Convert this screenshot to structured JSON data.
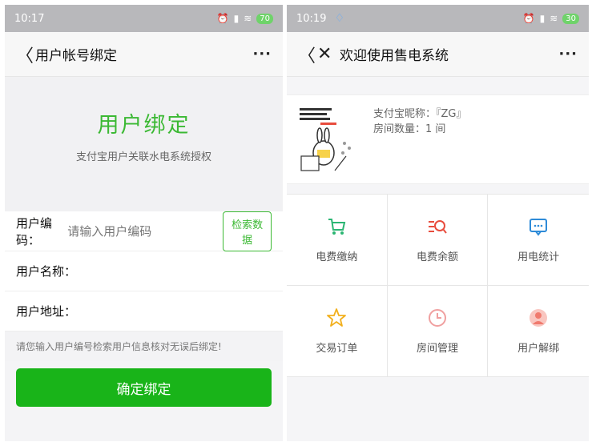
{
  "left": {
    "status": {
      "time": "10:17",
      "battery": "70"
    },
    "nav": {
      "title": "用户帐号绑定",
      "more": "···"
    },
    "hero": {
      "title": "用户绑定",
      "subtitle": "支付宝用户关联水电系统授权"
    },
    "form": {
      "code_label": "用户编码：",
      "code_placeholder": "请输入用户编码",
      "search_button": "检索数据",
      "name_label": "用户名称：",
      "address_label": "用户地址："
    },
    "hint": "请您输入用户编号检索用户信息核对无误后绑定!",
    "confirm_button": "确定绑定"
  },
  "right": {
    "status": {
      "time": "10:19",
      "battery": "30"
    },
    "nav": {
      "title": "欢迎使用售电系统",
      "more": "···"
    },
    "profile": {
      "nickname": "支付宝昵称：『ZG』",
      "rooms": "房间数量：1 间"
    },
    "grid": [
      {
        "label": "电费缴纳",
        "icon": "cart-icon",
        "color": "#2bb673"
      },
      {
        "label": "电费余额",
        "icon": "balance-search-icon",
        "color": "#e84c3d"
      },
      {
        "label": "用电统计",
        "icon": "chat-stats-icon",
        "color": "#2e8bd8"
      },
      {
        "label": "交易订单",
        "icon": "star-icon",
        "color": "#f2b01e"
      },
      {
        "label": "房间管理",
        "icon": "clock-icon",
        "color": "#f0a0a0"
      },
      {
        "label": "用户解绑",
        "icon": "user-unbind-icon",
        "color": "#f09090"
      }
    ]
  }
}
